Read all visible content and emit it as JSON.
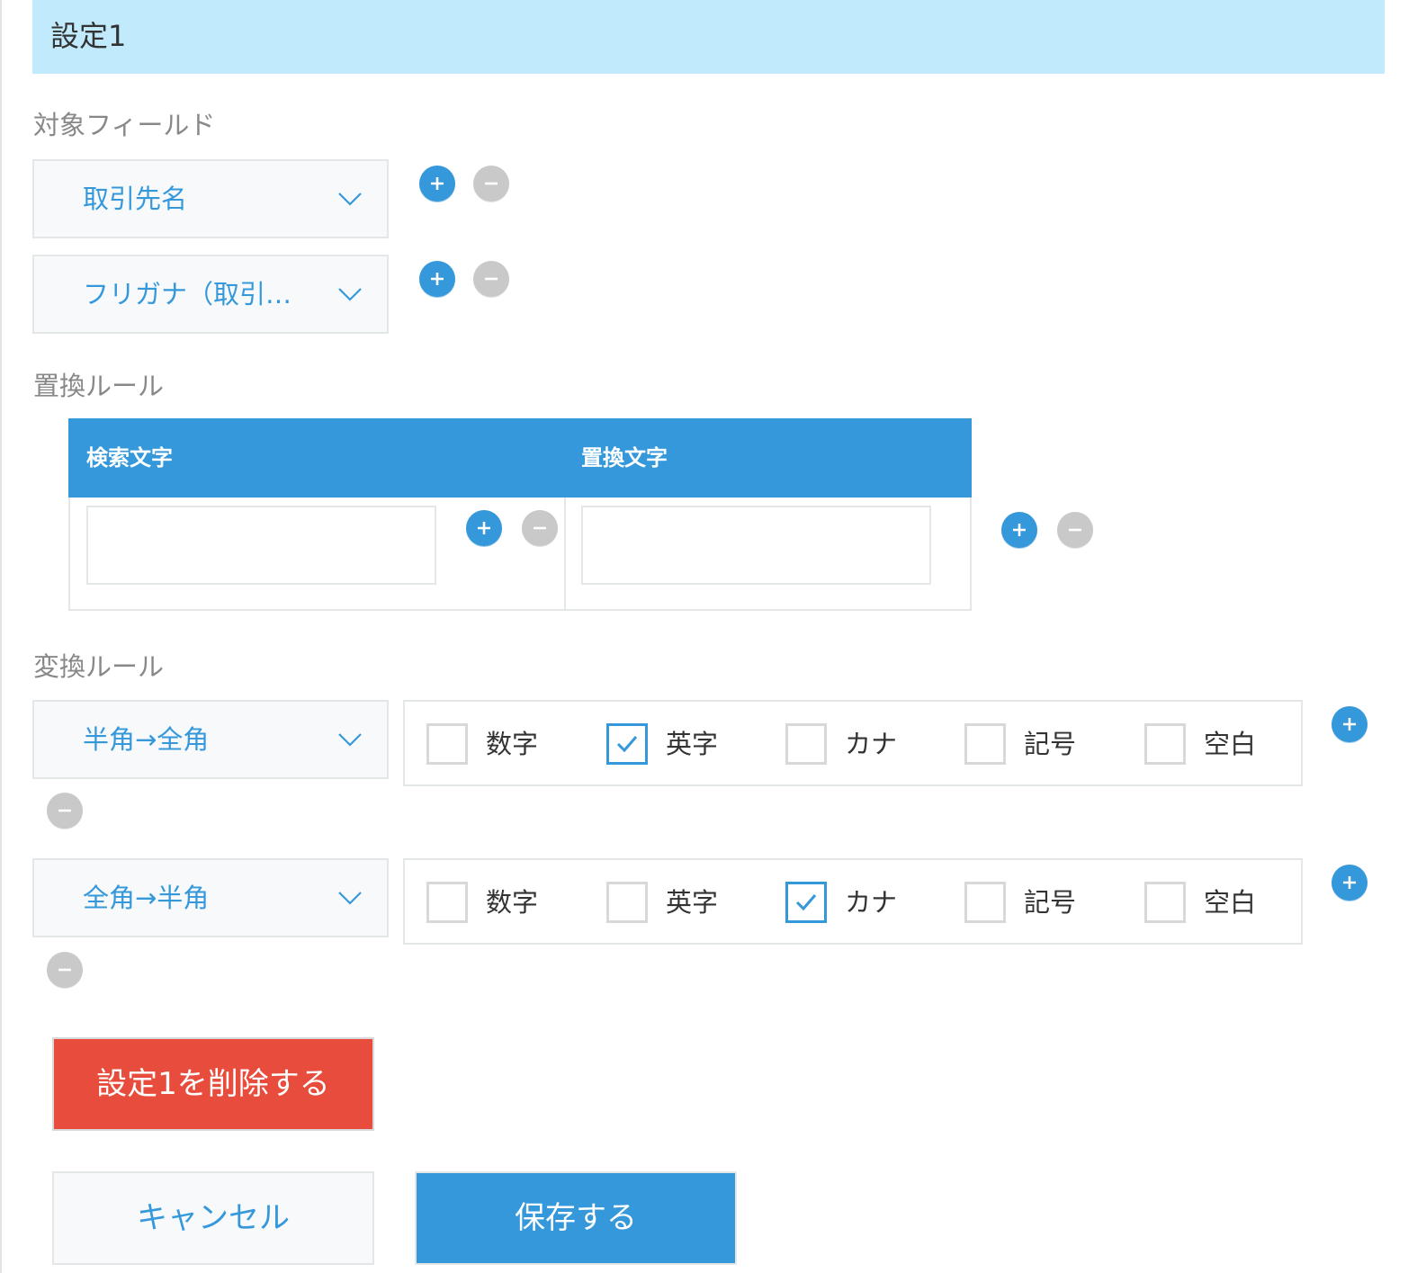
{
  "header": {
    "title": "設定1"
  },
  "target_fields": {
    "label": "対象フィールド",
    "items": [
      {
        "value": "取引先名"
      },
      {
        "value": "フリガナ（取引…"
      }
    ]
  },
  "replace_rules": {
    "label": "置換ルール",
    "columns": [
      "検索文字",
      "置換文字"
    ],
    "search_value": "",
    "replace_value": ""
  },
  "convert_rules": {
    "label": "変換ルール",
    "options": [
      "数字",
      "英字",
      "カナ",
      "記号",
      "空白"
    ],
    "rows": [
      {
        "mode": "半角→全角",
        "checked": [
          false,
          true,
          false,
          false,
          false
        ]
      },
      {
        "mode": "全角→半角",
        "checked": [
          false,
          false,
          true,
          false,
          false
        ]
      }
    ]
  },
  "buttons": {
    "delete": "設定1を削除する",
    "cancel": "キャンセル",
    "save": "保存する"
  },
  "colors": {
    "header_bg": "#c1ebfd",
    "accent": "#3498db",
    "danger": "#e74c3c",
    "muted": "#c9c9c9"
  },
  "icons": {
    "add": "plus-circle-icon",
    "remove": "minus-circle-icon",
    "dropdown": "chevron-down-icon",
    "check": "check-icon"
  }
}
